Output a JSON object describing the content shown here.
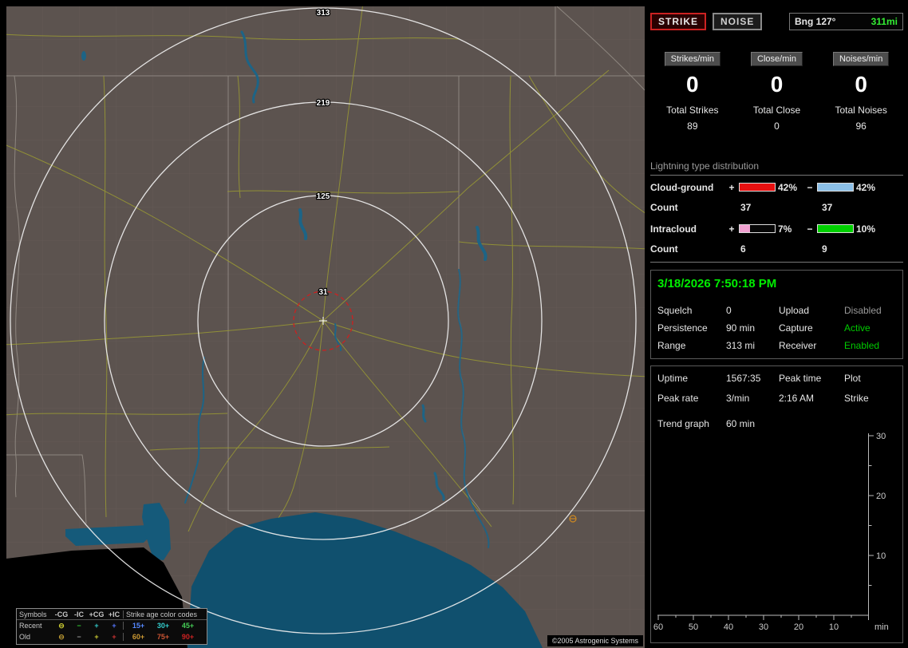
{
  "map": {
    "ring_labels": [
      "313",
      "219",
      "125",
      "31"
    ],
    "copyright": "©2005 Astrogenic Systems",
    "legend": {
      "header_symbols": "Symbols",
      "columns": [
        "-CG",
        "-IC",
        "+CG",
        "+IC"
      ],
      "age_header": "Strike age color codes",
      "rows": [
        {
          "label": "Recent",
          "symbols": [
            {
              "glyph": "⊖",
              "color": "#cccc33"
            },
            {
              "glyph": "−",
              "color": "#33cc33"
            },
            {
              "glyph": "+",
              "color": "#33cccc"
            },
            {
              "glyph": "+",
              "color": "#5577ff"
            }
          ],
          "ages": [
            {
              "text": "15+",
              "color": "#5588ff"
            },
            {
              "text": "30+",
              "color": "#33cccc"
            },
            {
              "text": "45+",
              "color": "#44cc55"
            }
          ]
        },
        {
          "label": "Old",
          "symbols": [
            {
              "glyph": "⊖",
              "color": "#bb9933"
            },
            {
              "glyph": "−",
              "color": "#999999"
            },
            {
              "glyph": "+",
              "color": "#cccc33"
            },
            {
              "glyph": "+",
              "color": "#cc3333"
            }
          ],
          "ages": [
            {
              "text": "60+",
              "color": "#cc9933"
            },
            {
              "text": "75+",
              "color": "#cc5533"
            },
            {
              "text": "90+",
              "color": "#cc2222"
            }
          ]
        }
      ]
    }
  },
  "sidebar": {
    "mode_buttons": {
      "strike": "STRIKE",
      "noise": "NOISE"
    },
    "bearing": {
      "label": "Bng 127°",
      "distance": "311mi",
      "distance_color": "#33ee33"
    },
    "counters": [
      {
        "header": "Strikes/min",
        "value": "0",
        "total_label": "Total Strikes",
        "total": "89"
      },
      {
        "header": "Close/min",
        "value": "0",
        "total_label": "Total Close",
        "total": "0"
      },
      {
        "header": "Noises/min",
        "value": "0",
        "total_label": "Total Noises",
        "total": "96"
      }
    ],
    "distribution": {
      "title": "Lightning type distribution",
      "rows": [
        {
          "label": "Cloud-ground",
          "plus_sign": "+",
          "minus_sign": "−",
          "plus_pct": "42%",
          "minus_pct": "42%",
          "plus_bar": {
            "fill_pct": 100,
            "color": "#e81010"
          },
          "minus_bar": {
            "fill_pct": 100,
            "color": "#8cc0e8"
          },
          "count_label": "Count",
          "plus_count": "37",
          "minus_count": "37"
        },
        {
          "label": "Intracloud",
          "plus_sign": "+",
          "minus_sign": "−",
          "plus_pct": "7%",
          "minus_pct": "10%",
          "plus_bar": {
            "fill_pct": 30,
            "color": "#f0a0d0"
          },
          "minus_bar": {
            "fill_pct": 100,
            "color": "#00d000"
          },
          "count_label": "Count",
          "plus_count": "6",
          "minus_count": "9"
        }
      ]
    },
    "status_panel": {
      "timestamp": "3/18/2026 7:50:18 PM",
      "timestamp_color": "#00ee00",
      "rows": [
        {
          "k1": "Squelch",
          "v1": "0",
          "k2": "Upload",
          "v2": "Disabled",
          "v2_color": "#9a9a9a"
        },
        {
          "k1": "Persistence",
          "v1": "90 min",
          "k2": "Capture",
          "v2": "Active",
          "v2_color": "#00cc00"
        },
        {
          "k1": "Range",
          "v1": "313 mi",
          "k2": "Receiver",
          "v2": "Enabled",
          "v2_color": "#00cc00"
        }
      ]
    },
    "stats_panel": {
      "uptime_label": "Uptime",
      "uptime_value": "1567:35",
      "peak_time_label": "Peak time",
      "peak_time_value": "2:16 AM",
      "plot_label": "Plot",
      "plot_value": "Strike",
      "peak_rate_label": "Peak rate",
      "peak_rate_value": "3/min",
      "trend_label": "Trend graph",
      "trend_value": "60 min"
    },
    "trend_chart": {
      "type": "line",
      "title": "Strike trend graph (60 min)",
      "y_ticks": [
        "30",
        "20",
        "10"
      ],
      "x_ticks": [
        "60",
        "50",
        "40",
        "30",
        "20",
        "10"
      ],
      "x_unit": "min",
      "y_range": [
        0,
        30
      ],
      "x_range_minutes": [
        60,
        0
      ],
      "series": []
    }
  }
}
